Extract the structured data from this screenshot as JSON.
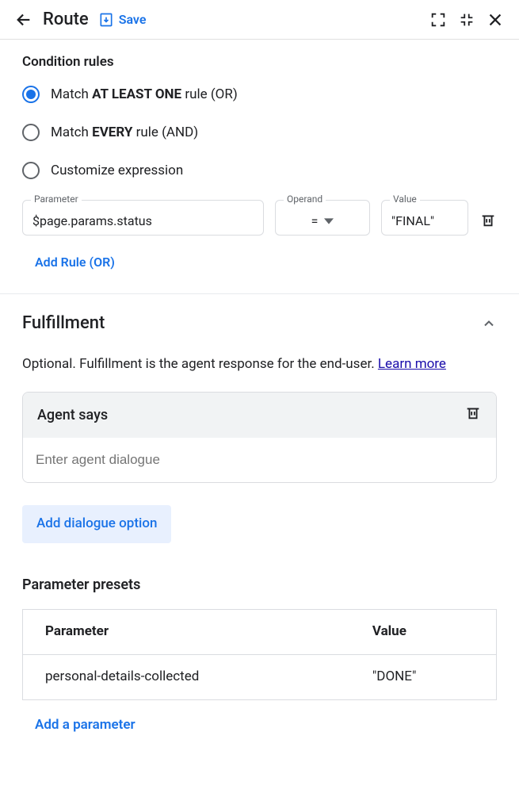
{
  "header": {
    "title": "Route",
    "save": "Save"
  },
  "condition": {
    "title": "Condition rules",
    "options": {
      "or_prefix": "Match ",
      "or_bold": "AT LEAST ONE",
      "or_suffix": " rule (OR)",
      "and_prefix": "Match ",
      "and_bold": "EVERY",
      "and_suffix": " rule (AND)",
      "custom": "Customize expression"
    },
    "labels": {
      "parameter": "Parameter",
      "operand": "Operand",
      "value": "Value"
    },
    "rule": {
      "parameter": "$page.params.status",
      "operand": "=",
      "value": "\"FINAL\""
    },
    "add_rule": "Add Rule (OR)"
  },
  "fulfillment": {
    "title": "Fulfillment",
    "desc_prefix": "Optional. Fulfillment is the agent response for the end-user. ",
    "learn_more": "Learn more",
    "agent_header": "Agent says",
    "agent_placeholder": "Enter agent dialogue",
    "add_dialogue": "Add dialogue option",
    "presets_title": "Parameter presets",
    "presets_headers": {
      "parameter": "Parameter",
      "value": "Value"
    },
    "preset_row": {
      "parameter": "personal-details-collected",
      "value": "\"DONE\""
    },
    "add_parameter": "Add a parameter"
  }
}
